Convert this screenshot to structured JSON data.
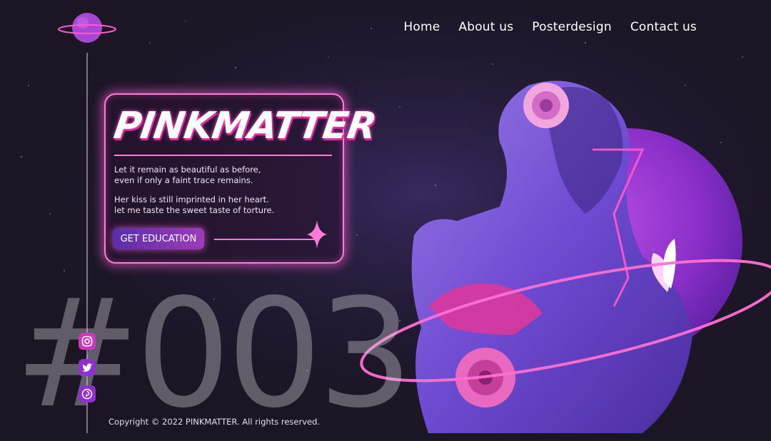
{
  "nav": {
    "items": [
      {
        "label": "Home"
      },
      {
        "label": "About us"
      },
      {
        "label": "Posterdesign"
      },
      {
        "label": "Contact us"
      }
    ]
  },
  "card": {
    "title": "PINKMATTER",
    "paragraph1": [
      "Let it remain as beautiful as before,",
      "even if only a faint trace remains."
    ],
    "paragraph2": [
      "Her kiss is still imprinted in her heart.",
      "let me taste the sweet taste of torture."
    ],
    "button_label": "GET EDUCATION"
  },
  "big_number": "#003",
  "social": [
    {
      "icon": "instagram-icon"
    },
    {
      "icon": "twitter-icon"
    },
    {
      "icon": "pinterest-icon"
    }
  ],
  "footer": {
    "copyright": "Copyright © 2022 PINKMATTER. All rights reserved."
  },
  "colors": {
    "accent": "#ff7ad9",
    "purple": "#8f2fd0",
    "background": "#1b1524"
  }
}
